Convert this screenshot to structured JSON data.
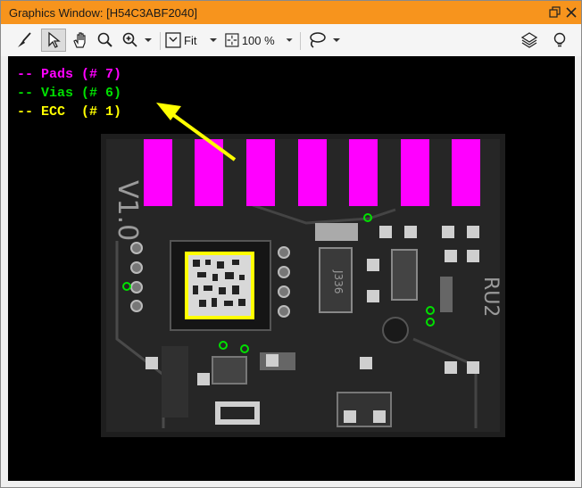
{
  "window": {
    "title": "Graphics Window: [H54C3ABF2040]"
  },
  "toolbar": {
    "fit_label": "Fit",
    "zoom_label": "100 %",
    "tools": [
      "broom-icon",
      "pointer-icon",
      "hand-icon",
      "magnifier-icon",
      "zoom-icon",
      "fit-icon",
      "zoom-box-icon",
      "lasso-icon",
      "layers-icon",
      "lightbulb-icon"
    ]
  },
  "legend": {
    "pads": "-- Pads (# 7)",
    "vias": "-- Vias (# 6)",
    "ecc": "-- ECC  (# 1)"
  },
  "colors": {
    "accent": "#f7941d",
    "pads": "#ff00ff",
    "vias": "#00e000",
    "ecc": "#ffff00"
  }
}
